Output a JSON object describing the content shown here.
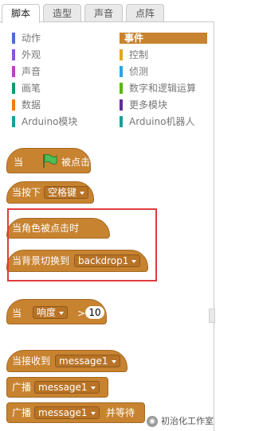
{
  "tabs": [
    {
      "label": "脚本",
      "active": true
    },
    {
      "label": "造型",
      "active": false
    },
    {
      "label": "声音",
      "active": false
    },
    {
      "label": "点阵",
      "active": false
    }
  ],
  "categories": [
    {
      "label": "动作",
      "color": "#4a6cd4",
      "selected": false
    },
    {
      "label": "事件",
      "color": "#c88330",
      "selected": true
    },
    {
      "label": "外观",
      "color": "#8a55d7",
      "selected": false
    },
    {
      "label": "控制",
      "color": "#e1a91a",
      "selected": false
    },
    {
      "label": "声音",
      "color": "#bb42c3",
      "selected": false
    },
    {
      "label": "侦测",
      "color": "#2ca5e2",
      "selected": false
    },
    {
      "label": "画笔",
      "color": "#0e9a6c",
      "selected": false
    },
    {
      "label": "数字和逻辑运算",
      "color": "#5cb712",
      "selected": false
    },
    {
      "label": "数据",
      "color": "#ee7d16",
      "selected": false
    },
    {
      "label": "更多模块",
      "color": "#632d99",
      "selected": false
    },
    {
      "label": "Arduino模块",
      "color": "#17a19a",
      "selected": false
    },
    {
      "label": "Arduino机器人",
      "color": "#17a19a",
      "selected": false
    }
  ],
  "blocks": {
    "flag_hat": {
      "prefix": "当",
      "suffix": "被点击"
    },
    "key_hat": {
      "prefix": "当按下",
      "key": "空格键"
    },
    "sprite_click_hat": {
      "label": "当角色被点击时"
    },
    "backdrop_hat": {
      "prefix": "当背景切换到",
      "value": "backdrop1"
    },
    "sensor_hat": {
      "prefix": "当",
      "sensor": "响度",
      "op": ">",
      "value": "10"
    },
    "receive_hat": {
      "prefix": "当接收到",
      "message": "message1"
    },
    "broadcast": {
      "prefix": "广播",
      "message": "message1"
    },
    "broadcast_wait": {
      "prefix": "广播",
      "message": "message1",
      "suffix": "并等待"
    }
  },
  "watermark": {
    "text": "初治化工作室"
  },
  "colors": {
    "event": "#c88330",
    "highlight": "#e03c3c",
    "flag": "#4cbf56"
  }
}
